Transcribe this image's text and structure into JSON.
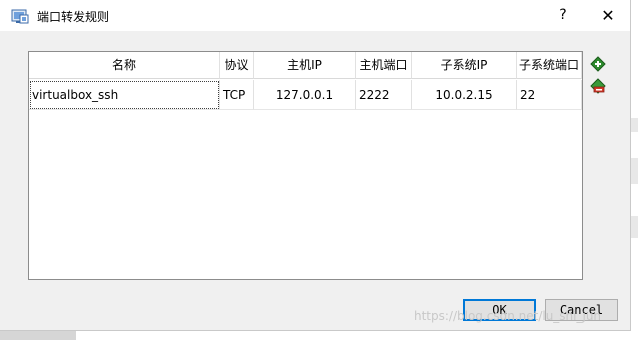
{
  "window": {
    "title": "端口转发规则",
    "help_glyph": "?",
    "close_glyph": "✕"
  },
  "table": {
    "columns": [
      "名称",
      "协议",
      "主机IP",
      "主机端口",
      "子系统IP",
      "子系统端口"
    ],
    "rows": [
      [
        "virtualbox_ssh",
        "TCP",
        "127.0.0.1",
        "2222",
        "10.0.2.15",
        "22"
      ]
    ]
  },
  "side_actions": {
    "add_icon": "add-rule-icon",
    "remove_icon": "remove-rule-icon"
  },
  "buttons": {
    "ok": "OK",
    "cancel": "Cancel"
  },
  "watermark": "https://blog.csdn.net/lu_shi_jun"
}
